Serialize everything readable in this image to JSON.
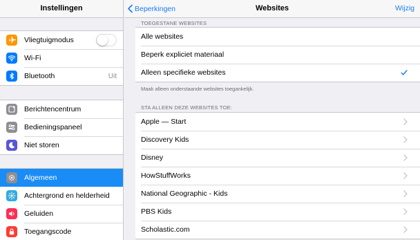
{
  "sidebar": {
    "title": "Instellingen",
    "groups": [
      [
        {
          "label": "Vliegtuigmodus",
          "icon": "airplane-icon",
          "color": "#ff9500",
          "control": "toggle",
          "toggle_on": false
        },
        {
          "label": "Wi-Fi",
          "icon": "wifi-icon",
          "color": "#007aff"
        },
        {
          "label": "Bluetooth",
          "icon": "bluetooth-icon",
          "color": "#007aff",
          "value": "Uit"
        }
      ],
      [
        {
          "label": "Berichtencentrum",
          "icon": "notification-center-icon",
          "color": "#8e8e93"
        },
        {
          "label": "Bedieningspaneel",
          "icon": "control-center-icon",
          "color": "#8e8e93"
        },
        {
          "label": "Niet storen",
          "icon": "moon-icon",
          "color": "#5856d6"
        }
      ],
      [
        {
          "label": "Algemeen",
          "icon": "gear-icon",
          "color": "#8e8e93",
          "selected": true
        },
        {
          "label": "Achtergrond en helderheid",
          "icon": "wallpaper-icon",
          "color": "#34aadc"
        },
        {
          "label": "Geluiden",
          "icon": "speaker-icon",
          "color": "#ff2d55"
        },
        {
          "label": "Toegangscode",
          "icon": "lock-icon",
          "color": "#ff3b30"
        }
      ]
    ]
  },
  "nav": {
    "back_label": "Beperkingen",
    "title": "Websites",
    "edit_label": "Wijzig"
  },
  "allowed": {
    "header": "TOEGESTANE WEBSITES",
    "options": [
      {
        "label": "Alle websites",
        "checked": false
      },
      {
        "label": "Beperk expliciet materiaal",
        "checked": false
      },
      {
        "label": "Alleen specifieke websites",
        "checked": true
      }
    ],
    "footer": "Maak alleen onderstaande websites toegankelijk."
  },
  "only": {
    "header": "STA ALLEEN DEZE WEBSITES TOE:",
    "sites": [
      "Apple — Start",
      "Discovery Kids",
      "Disney",
      "HowStuffWorks",
      "National Geographic - Kids",
      "PBS Kids",
      "Scholastic.com"
    ]
  },
  "colors": {
    "accent": "#1a7cf5",
    "selected_row": "#1a8cf5"
  }
}
